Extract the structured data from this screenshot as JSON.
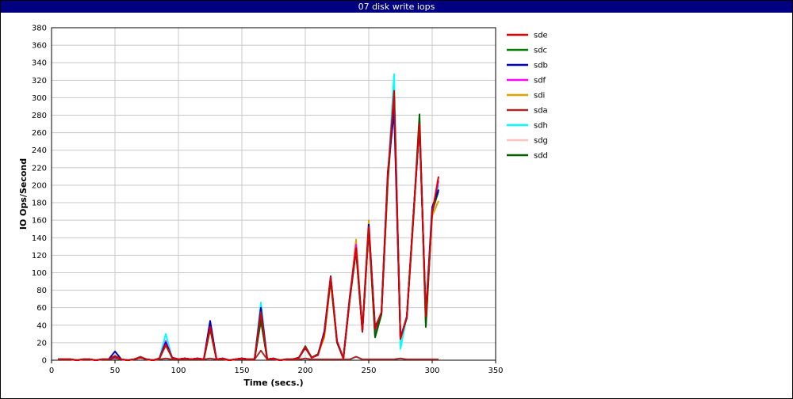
{
  "chart_data": {
    "type": "line",
    "title": "07 disk write iops",
    "xlabel": "Time (secs.)",
    "ylabel": "IO Ops/Second",
    "xlim": [
      0,
      350
    ],
    "ylim": [
      0,
      380
    ],
    "xticks": [
      0,
      50,
      100,
      150,
      200,
      250,
      300,
      350
    ],
    "yticks": [
      0,
      20,
      40,
      60,
      80,
      100,
      120,
      140,
      160,
      180,
      200,
      220,
      240,
      260,
      280,
      300,
      320,
      340,
      360,
      380
    ],
    "grid": true,
    "legend_position": "right",
    "x": [
      5,
      10,
      15,
      20,
      25,
      30,
      35,
      40,
      45,
      50,
      55,
      60,
      65,
      70,
      75,
      80,
      85,
      90,
      95,
      100,
      105,
      110,
      115,
      120,
      125,
      130,
      135,
      140,
      145,
      150,
      155,
      160,
      165,
      170,
      175,
      180,
      185,
      190,
      195,
      200,
      205,
      210,
      215,
      220,
      225,
      230,
      235,
      240,
      245,
      250,
      255,
      260,
      265,
      270,
      275,
      280,
      285,
      290,
      295,
      300,
      305
    ],
    "series": [
      {
        "name": "sde",
        "color": "#e00000",
        "values": [
          1,
          1,
          1,
          0,
          1,
          1,
          0,
          1,
          1,
          5,
          1,
          0,
          1,
          3,
          1,
          0,
          2,
          18,
          3,
          1,
          2,
          1,
          2,
          1,
          38,
          1,
          2,
          0,
          1,
          2,
          1,
          1,
          55,
          1,
          2,
          0,
          1,
          1,
          3,
          15,
          3,
          6,
          30,
          95,
          22,
          2,
          70,
          128,
          34,
          152,
          36,
          55,
          210,
          308,
          24,
          50,
          160,
          270,
          50,
          168,
          210
        ]
      },
      {
        "name": "sdc",
        "color": "#008000",
        "values": [
          1,
          1,
          1,
          0,
          1,
          1,
          0,
          1,
          1,
          4,
          1,
          0,
          1,
          3,
          1,
          0,
          2,
          17,
          3,
          1,
          2,
          1,
          2,
          1,
          36,
          1,
          2,
          0,
          1,
          2,
          1,
          1,
          45,
          1,
          2,
          0,
          1,
          1,
          3,
          16,
          3,
          7,
          32,
          92,
          20,
          2,
          68,
          125,
          33,
          150,
          26,
          52,
          205,
          300,
          25,
          48,
          158,
          275,
          40,
          170,
          195
        ]
      },
      {
        "name": "sdb",
        "color": "#0000c0",
        "values": [
          1,
          1,
          1,
          0,
          1,
          1,
          0,
          1,
          1,
          10,
          1,
          0,
          1,
          3,
          1,
          0,
          2,
          20,
          3,
          1,
          2,
          1,
          2,
          1,
          45,
          1,
          2,
          0,
          1,
          2,
          1,
          1,
          60,
          1,
          2,
          0,
          1,
          1,
          3,
          14,
          3,
          6,
          33,
          96,
          21,
          2,
          72,
          127,
          35,
          155,
          38,
          54,
          215,
          285,
          26,
          49,
          162,
          268,
          52,
          175,
          195
        ]
      },
      {
        "name": "sdf",
        "color": "#ff00ff",
        "values": [
          1,
          1,
          1,
          0,
          1,
          1,
          0,
          1,
          1,
          3,
          1,
          0,
          1,
          3,
          1,
          0,
          2,
          22,
          3,
          1,
          2,
          1,
          2,
          1,
          37,
          1,
          2,
          0,
          1,
          2,
          1,
          1,
          52,
          1,
          2,
          0,
          1,
          1,
          3,
          15,
          3,
          6,
          31,
          93,
          22,
          2,
          71,
          132,
          32,
          153,
          34,
          53,
          208,
          305,
          25,
          50,
          160,
          272,
          48,
          170,
          205
        ]
      },
      {
        "name": "sdi",
        "color": "#e0a000",
        "values": [
          1,
          1,
          1,
          0,
          1,
          1,
          0,
          1,
          1,
          3,
          1,
          0,
          1,
          3,
          1,
          0,
          2,
          18,
          3,
          1,
          2,
          1,
          2,
          1,
          35,
          1,
          2,
          0,
          1,
          2,
          1,
          1,
          50,
          1,
          2,
          0,
          1,
          1,
          3,
          14,
          3,
          7,
          26,
          90,
          20,
          2,
          70,
          138,
          35,
          160,
          30,
          52,
          202,
          302,
          25,
          49,
          156,
          272,
          50,
          165,
          182
        ]
      },
      {
        "name": "sda",
        "color": "#a52a2a",
        "values": [
          1,
          1,
          1,
          0,
          1,
          1,
          0,
          1,
          1,
          2,
          1,
          0,
          1,
          4,
          1,
          0,
          1,
          2,
          1,
          1,
          1,
          1,
          1,
          1,
          2,
          1,
          1,
          0,
          1,
          1,
          1,
          1,
          11,
          1,
          1,
          0,
          1,
          1,
          1,
          2,
          1,
          1,
          1,
          1,
          1,
          1,
          1,
          4,
          1,
          1,
          1,
          1,
          1,
          1,
          2,
          1,
          1,
          1,
          1,
          1,
          1
        ]
      },
      {
        "name": "sdh",
        "color": "#00ffff",
        "values": [
          1,
          1,
          1,
          0,
          1,
          1,
          0,
          1,
          1,
          5,
          1,
          0,
          1,
          3,
          1,
          0,
          2,
          30,
          3,
          1,
          2,
          1,
          2,
          1,
          40,
          1,
          2,
          0,
          1,
          2,
          1,
          1,
          66,
          1,
          2,
          0,
          1,
          1,
          3,
          15,
          3,
          6,
          30,
          94,
          21,
          2,
          70,
          130,
          34,
          152,
          35,
          54,
          210,
          327,
          13,
          50,
          160,
          270,
          50,
          168,
          200
        ]
      },
      {
        "name": "sdg",
        "color": "#ffc0c0",
        "values": [
          1,
          1,
          1,
          0,
          1,
          1,
          0,
          1,
          1,
          4,
          1,
          0,
          1,
          3,
          1,
          0,
          2,
          16,
          3,
          1,
          2,
          1,
          2,
          1,
          36,
          1,
          2,
          0,
          1,
          2,
          1,
          1,
          48,
          1,
          2,
          0,
          1,
          1,
          3,
          15,
          3,
          6,
          30,
          94,
          21,
          2,
          70,
          126,
          34,
          150,
          35,
          54,
          208,
          300,
          24,
          50,
          160,
          270,
          50,
          168,
          200
        ]
      },
      {
        "name": "sdd",
        "color": "#006000",
        "values": [
          1,
          1,
          1,
          0,
          1,
          1,
          0,
          1,
          1,
          4,
          1,
          0,
          1,
          3,
          1,
          0,
          2,
          19,
          3,
          1,
          2,
          1,
          2,
          1,
          36,
          1,
          2,
          0,
          1,
          2,
          1,
          1,
          46,
          1,
          2,
          0,
          1,
          1,
          3,
          16,
          3,
          7,
          31,
          93,
          21,
          2,
          69,
          126,
          33,
          151,
          27,
          53,
          207,
          303,
          25,
          49,
          159,
          281,
          38,
          170,
          193
        ]
      }
    ]
  }
}
